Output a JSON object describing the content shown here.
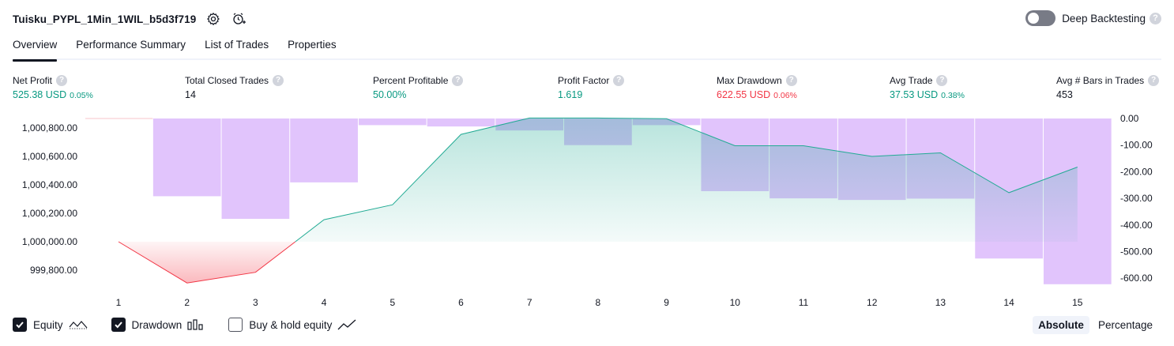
{
  "header": {
    "title": "Tuisku_PYPL_1Min_1WIL_b5d3f719"
  },
  "deep_backtesting": {
    "label": "Deep Backtesting",
    "help": "?"
  },
  "tabs": [
    {
      "label": "Overview",
      "active": true
    },
    {
      "label": "Performance Summary",
      "active": false
    },
    {
      "label": "List of Trades",
      "active": false
    },
    {
      "label": "Properties",
      "active": false
    }
  ],
  "metrics": {
    "net_profit": {
      "label": "Net Profit",
      "value": "525.38 USD",
      "pct": "0.05%"
    },
    "total_closed_trades": {
      "label": "Total Closed Trades",
      "value": "14"
    },
    "percent_profitable": {
      "label": "Percent Profitable",
      "value": "50.00%"
    },
    "profit_factor": {
      "label": "Profit Factor",
      "value": "1.619"
    },
    "max_drawdown": {
      "label": "Max Drawdown",
      "value": "622.55 USD",
      "pct": "0.06%"
    },
    "avg_trade": {
      "label": "Avg Trade",
      "value": "37.53 USD",
      "pct": "0.38%"
    },
    "avg_bars": {
      "label": "Avg # Bars in Trades",
      "value": "453"
    }
  },
  "colors": {
    "profit": "#089981",
    "loss": "#f23645",
    "drawdown_bar": "#e1c4fc",
    "equity_line": "#22ab94"
  },
  "chart_data": {
    "type": "line",
    "x": [
      1,
      2,
      3,
      4,
      5,
      6,
      7,
      8,
      9,
      10,
      11,
      12,
      13,
      14,
      15
    ],
    "x_tick_labels": [
      "1",
      "2",
      "3",
      "4",
      "5",
      "6",
      "7",
      "8",
      "9",
      "10",
      "11",
      "12",
      "13",
      "14",
      "15"
    ],
    "left_axis_ticks": [
      "1,000,800.00",
      "1,000,600.00",
      "1,000,400.00",
      "1,000,200.00",
      "1,000,000.00",
      "999,800.00"
    ],
    "right_axis_ticks": [
      "0.00",
      "-100.00",
      "-200.00",
      "-300.00",
      "-400.00",
      "-500.00",
      "-600.00"
    ],
    "series": [
      {
        "name": "Equity",
        "axis": "left",
        "values": [
          1000000,
          999710,
          999785,
          1000155,
          1000260,
          1000755,
          1000870,
          1000870,
          1000865,
          1000675,
          1000675,
          1000600,
          1000625,
          1000345,
          1000525
        ]
      },
      {
        "name": "Drawdown",
        "axis": "right",
        "type": "bar",
        "values": [
          0,
          -292,
          -377,
          -240,
          -25,
          -30,
          -45,
          -100,
          -25,
          -273,
          -300,
          -306,
          -301,
          -526,
          -622.55
        ]
      }
    ],
    "left_ylim": [
      999700,
      1000870
    ],
    "right_ylim": [
      -620,
      0
    ]
  },
  "footer": {
    "equity": {
      "label": "Equity",
      "checked": true
    },
    "drawdown": {
      "label": "Drawdown",
      "checked": true
    },
    "buy_hold": {
      "label": "Buy & hold equity",
      "checked": false
    },
    "absolute": "Absolute",
    "percentage": "Percentage"
  }
}
